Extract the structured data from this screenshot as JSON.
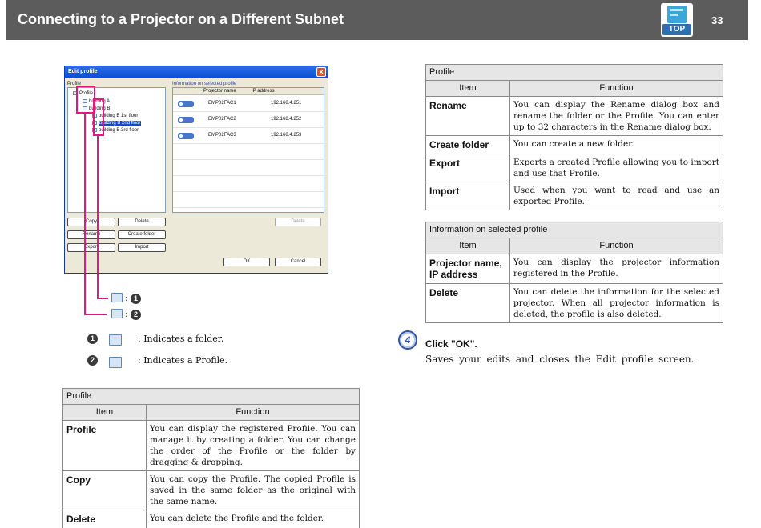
{
  "header": {
    "title": "Connecting to a Projector on a Different Subnet",
    "page_number": "33",
    "top_label": "TOP"
  },
  "dialog": {
    "title": "Edit profile",
    "close_glyph": "×",
    "profile_label": "Profile",
    "info_label": "Information on selected profile",
    "tree": [
      "Profile",
      "building A",
      "building B",
      "building B 1st floor",
      "building B 2nd floor",
      "building B 3rd floor"
    ],
    "columns": [
      "Projector name",
      "IP address"
    ],
    "rows": [
      {
        "name": "EMP02FAC1",
        "ip": "192.168.4.251"
      },
      {
        "name": "EMP02FAC2",
        "ip": "192.168.4.252"
      },
      {
        "name": "EMP02FAC3",
        "ip": "192.168.4.253"
      }
    ],
    "buttons": {
      "copy": "Copy",
      "delete": "Delete",
      "rename": "Rename",
      "create_folder": "Create folder",
      "export": "Export",
      "import": "Import",
      "info_delete": "Delete",
      "ok": "OK",
      "cancel": "Cancel"
    }
  },
  "callouts": {
    "one_marker": "1",
    "two_marker": "2",
    "colon": ":"
  },
  "legend": [
    {
      "marker": "1",
      "text": ": Indicates a folder."
    },
    {
      "marker": "2",
      "text": ": Indicates a Profile."
    }
  ],
  "tables": {
    "profile_left": {
      "caption": "Profile",
      "col_item": "Item",
      "col_function": "Function",
      "rows": [
        {
          "item": "Profile",
          "function": "You can display the registered Profile. You can manage it by creating a folder. You can change the order of the Profile or the folder by dragging & dropping."
        },
        {
          "item": "Copy",
          "function": "You can copy the Profile. The copied Profile is saved in the same folder as the original with the same name."
        },
        {
          "item": "Delete",
          "function": "You can delete the Profile and the folder."
        }
      ]
    },
    "profile_right": {
      "caption": "Profile",
      "col_item": "Item",
      "col_function": "Function",
      "rows": [
        {
          "item": "Rename",
          "function": "You can display the Rename dialog box and rename the folder or the Profile. You can enter up to 32 characters in the Rename dialog box."
        },
        {
          "item": "Create folder",
          "function": "You can create a new folder."
        },
        {
          "item": "Export",
          "function": "Exports a created Profile allowing you to import and use that Profile."
        },
        {
          "item": "Import",
          "function": "Used when you want to read and use an exported Profile."
        }
      ]
    },
    "info": {
      "caption": "Information on selected profile",
      "col_item": "Item",
      "col_function": "Function",
      "rows": [
        {
          "item": "Projector name, IP address",
          "function": "You can display the projector information registered in the Profile."
        },
        {
          "item": "Delete",
          "function": "You can delete the information for the selected projector. When all projector information is deleted, the profile is also deleted."
        }
      ]
    }
  },
  "step": {
    "number": "4",
    "title": "Click  \"OK\".",
    "description": "Saves your edits and closes the Edit profile screen."
  },
  "colors": {
    "header_bg": "#5c5c5c",
    "highlight": "#e0187f",
    "step_blue": "#2f57a5"
  }
}
